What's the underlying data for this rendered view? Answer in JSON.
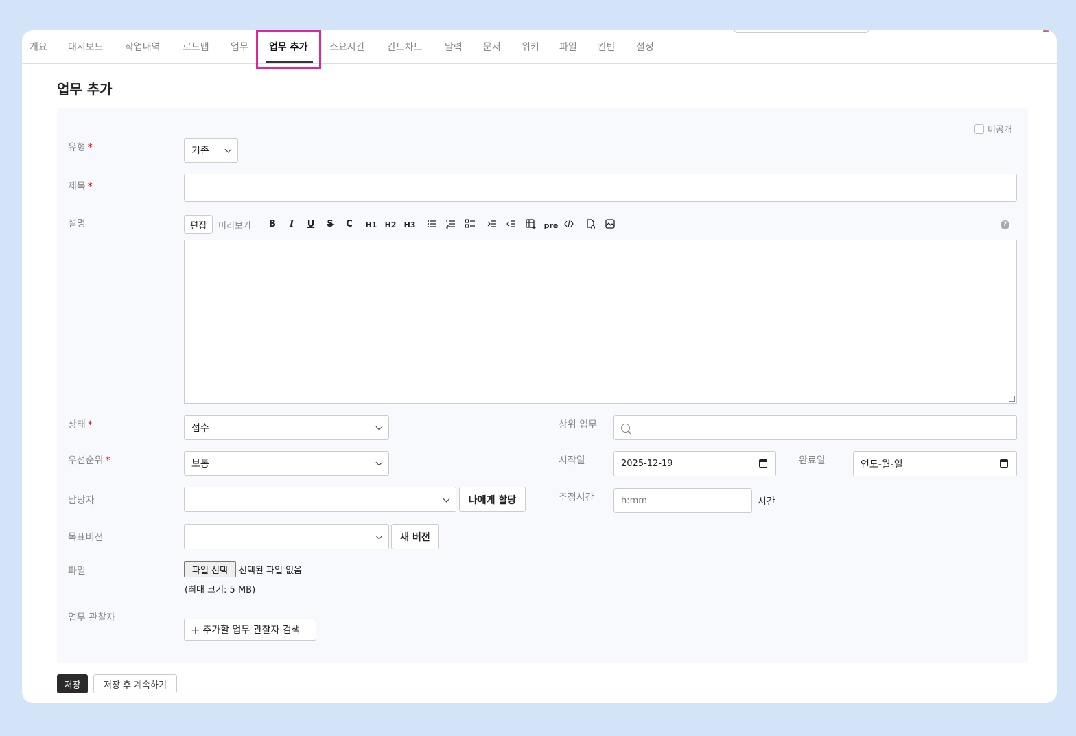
{
  "tabs": {
    "items": [
      "개요",
      "대시보드",
      "작업내역",
      "로드맵",
      "업무",
      "업무 추가",
      "소요시간",
      "간트차트",
      "달력",
      "문서",
      "위키",
      "파일",
      "칸반",
      "설정"
    ],
    "active": "업무 추가"
  },
  "page": {
    "title": "업무 추가"
  },
  "form": {
    "private_label": "비공개",
    "type": {
      "label": "유형",
      "required": "*",
      "value": "기존"
    },
    "subject": {
      "label": "제목",
      "required": "*",
      "value": ""
    },
    "description": {
      "label": "설명",
      "edit_tab": "편집",
      "preview_tab": "미리보기",
      "toolbar": {
        "bold": "B",
        "italic": "I",
        "underline": "U",
        "strike": "S",
        "code": "C",
        "h1": "H1",
        "h2": "H2",
        "h3": "H3",
        "pre": "pre",
        "help": "?"
      },
      "toolbar_icons": [
        "bold-icon",
        "italic-icon",
        "underline-icon",
        "strikethrough-icon",
        "inline-code-icon",
        "heading1-icon",
        "heading2-icon",
        "heading3-icon",
        "bullet-list-icon",
        "numbered-list-icon",
        "task-list-icon",
        "indent-icon",
        "outdent-icon",
        "table-icon",
        "pre-icon",
        "code-block-icon",
        "attach-file-icon",
        "image-icon",
        "help-icon"
      ]
    },
    "status": {
      "label": "상태",
      "required": "*",
      "value": "접수"
    },
    "priority": {
      "label": "우선순위",
      "required": "*",
      "value": "보통"
    },
    "assignee": {
      "label": "담당자",
      "value": "",
      "assign_me": "나에게 할당"
    },
    "target_version": {
      "label": "목표버전",
      "value": "",
      "new_version": "새 버전"
    },
    "file": {
      "label": "파일",
      "choose": "파일 선택",
      "none": "선택된 파일 없음",
      "max_size": "(최대 크기: 5 MB)"
    },
    "watchers": {
      "label": "업무 관찰자",
      "search": "추가할 업무 관찰자 검색"
    },
    "parent": {
      "label": "상위 업무",
      "value": ""
    },
    "start_date": {
      "label": "시작일",
      "value": "2025-12-19"
    },
    "due_date": {
      "label": "완료일",
      "placeholder": "연도-월-일"
    },
    "estimated": {
      "label": "추정시간",
      "placeholder": "h:mm",
      "unit": "시간"
    }
  },
  "actions": {
    "save": "저장",
    "save_continue": "저장 후 계속하기"
  },
  "colors": {
    "background": "#d3e4f8",
    "highlight": "#e0259a",
    "required": "#d40000",
    "save_button": "#2a2a2a"
  }
}
